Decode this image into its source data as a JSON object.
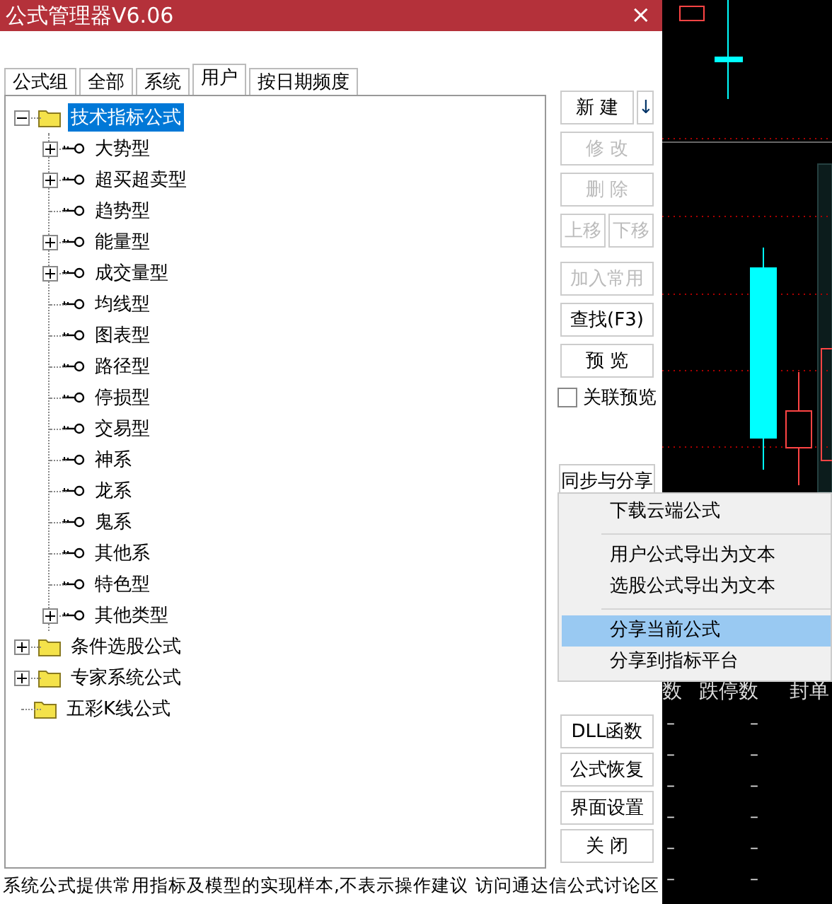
{
  "window": {
    "title": "公式管理器V6.06",
    "close": "×"
  },
  "tabs": [
    {
      "label": "公式组",
      "selected": false
    },
    {
      "label": "全部",
      "selected": false
    },
    {
      "label": "系统",
      "selected": false
    },
    {
      "label": "用户",
      "selected": true
    },
    {
      "label": "按日期频度",
      "selected": false
    }
  ],
  "tree": [
    {
      "label": "技术指标公式",
      "kind": "folder",
      "expandable": true,
      "expanded": true,
      "selected": true,
      "children": [
        {
          "label": "大势型",
          "kind": "key",
          "expandable": true,
          "expanded": false,
          "selected": false
        },
        {
          "label": "超买超卖型",
          "kind": "key",
          "expandable": true,
          "expanded": false,
          "selected": false
        },
        {
          "label": "趋势型",
          "kind": "key",
          "expandable": false,
          "selected": false
        },
        {
          "label": "能量型",
          "kind": "key",
          "expandable": true,
          "expanded": false,
          "selected": false
        },
        {
          "label": "成交量型",
          "kind": "key",
          "expandable": true,
          "expanded": false,
          "selected": false
        },
        {
          "label": "均线型",
          "kind": "key",
          "expandable": false,
          "selected": false
        },
        {
          "label": "图表型",
          "kind": "key",
          "expandable": false,
          "selected": false
        },
        {
          "label": "路径型",
          "kind": "key",
          "expandable": false,
          "selected": false
        },
        {
          "label": "停损型",
          "kind": "key",
          "expandable": false,
          "selected": false
        },
        {
          "label": "交易型",
          "kind": "key",
          "expandable": false,
          "selected": false
        },
        {
          "label": "神系",
          "kind": "key",
          "expandable": false,
          "selected": false
        },
        {
          "label": "龙系",
          "kind": "key",
          "expandable": false,
          "selected": false
        },
        {
          "label": "鬼系",
          "kind": "key",
          "expandable": false,
          "selected": false
        },
        {
          "label": "其他系",
          "kind": "key",
          "expandable": false,
          "selected": false
        },
        {
          "label": "特色型",
          "kind": "key",
          "expandable": false,
          "selected": false
        },
        {
          "label": "其他类型",
          "kind": "key",
          "expandable": true,
          "expanded": false,
          "selected": false
        }
      ]
    },
    {
      "label": "条件选股公式",
      "kind": "folder",
      "expandable": true,
      "expanded": false,
      "selected": false
    },
    {
      "label": "专家系统公式",
      "kind": "folder",
      "expandable": true,
      "expanded": false,
      "selected": false
    },
    {
      "label": "五彩K线公式",
      "kind": "folder",
      "expandable": false,
      "selected": false
    }
  ],
  "buttons": {
    "new": {
      "label": "新 建",
      "disabled": false
    },
    "new_menu": {
      "label": "↓",
      "disabled": false
    },
    "edit": {
      "label": "修 改",
      "disabled": true
    },
    "delete": {
      "label": "删 除",
      "disabled": true
    },
    "move_up": {
      "label": "上移",
      "disabled": true
    },
    "move_down": {
      "label": "下移",
      "disabled": true
    },
    "add_common": {
      "label": "加入常用",
      "disabled": true
    },
    "find": {
      "label": "查找(F3)",
      "disabled": false
    },
    "preview": {
      "label": "预 览",
      "disabled": false
    },
    "sync_share": {
      "label": "同步与分享",
      "disabled": false
    },
    "bottom": [
      {
        "label": "DLL函数",
        "disabled": false
      },
      {
        "label": "公式恢复",
        "disabled": false
      },
      {
        "label": "界面设置",
        "disabled": false
      },
      {
        "label": "关 闭",
        "disabled": false
      }
    ]
  },
  "linked_preview": {
    "label": "关联预览",
    "checked": false
  },
  "menu": [
    {
      "label": "下载云端公式",
      "selected": false,
      "separator_before": false
    },
    {
      "label": "用户公式导出为文本",
      "selected": false,
      "separator_before": true
    },
    {
      "label": "选股公式导出为文本",
      "selected": false,
      "separator_before": false
    },
    {
      "label": "分享当前公式",
      "selected": true,
      "separator_before": true
    },
    {
      "label": "分享到指标平台",
      "selected": false,
      "separator_before": false
    }
  ],
  "status": {
    "text": "系统公式提供常用指标及模型的实现样本,不表示操作建议",
    "link": "访问通达信公式讨论区"
  },
  "market_table": {
    "columns": [
      "数",
      "跌停数",
      "封单"
    ],
    "rows": [
      [
        "–",
        "–"
      ],
      [
        "–",
        "–"
      ],
      [
        "–",
        "–"
      ],
      [
        "–",
        "–"
      ],
      [
        "–",
        "–"
      ],
      [
        "–",
        "–"
      ]
    ]
  }
}
